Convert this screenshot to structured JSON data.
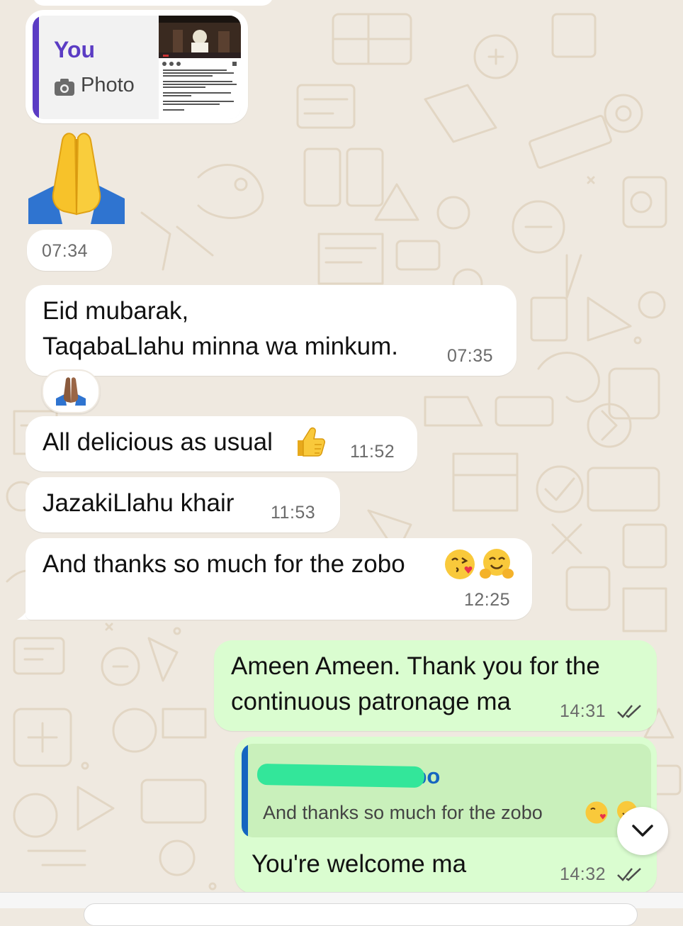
{
  "messages": [
    {
      "photo_reply": {
        "sender": "You",
        "label": "Photo",
        "sender_color": "#5b3cc4",
        "icon": "camera-icon"
      },
      "emoji": "folded-hands",
      "time": "07:34"
    },
    {
      "lines": [
        "Eid mubarak,",
        "TaqabaLlahu minna wa minkum."
      ],
      "time": "07:35",
      "reaction": "folded-hands"
    },
    {
      "text": "All delicious as usual",
      "emoji": "thumbs-up",
      "time": "11:52"
    },
    {
      "text": "JazakiLlahu khair",
      "time": "11:53"
    },
    {
      "text": "And thanks so much for the zobo",
      "emoji": [
        "face-blowing-kiss",
        "hugging-face"
      ],
      "time": "12:25"
    }
  ],
  "outgoing": [
    {
      "lines": [
        "Ameen Ameen. Thank you for the",
        "continuous patronage ma"
      ],
      "time": "14:31",
      "status": "read"
    },
    {
      "quote": {
        "sender": "ombo",
        "text": "And thanks so much for the zobo",
        "sender_color": "#1565c0",
        "redaction_color": "#33e69a"
      },
      "text": "You're welcome ma",
      "time": "14:32",
      "status": "read"
    }
  ],
  "controls": {
    "scroll_down_icon": "chevron-down-icon"
  },
  "colors": {
    "incoming_bubble": "#ffffff",
    "outgoing_bubble": "#dafdd0",
    "wallpaper": "#efe9e0",
    "read_ticks": "#4b4b4b"
  }
}
